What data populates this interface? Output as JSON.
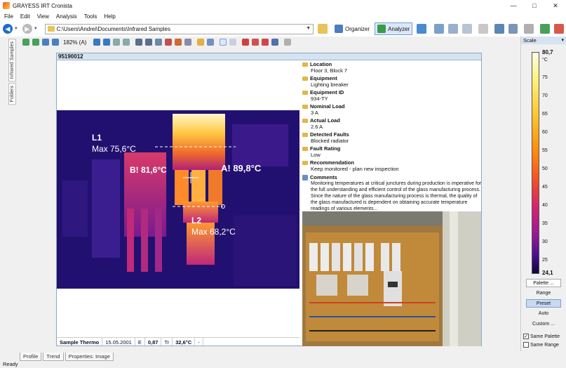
{
  "window": {
    "title": "GRAYESS IRT Cronista"
  },
  "menu": [
    "File",
    "Edit",
    "View",
    "Analysis",
    "Tools",
    "Help"
  ],
  "toolbar": {
    "path": "C:\\Users\\Andrei\\Documents\\Infrared Samples",
    "organizer_label": "Organizer",
    "analyzer_label": "Analyzer"
  },
  "image_toolbar": {
    "zoom": "182% (A)"
  },
  "left_tabs": [
    "Infrared Samples",
    "Folders"
  ],
  "image_panel": {
    "id": "95190012"
  },
  "thermal": {
    "labels": {
      "l1_name": "L1",
      "l1_max": "Max 75,6°C",
      "b_point": "B! 81,6°C",
      "a_point": "A! 89,8°C",
      "l2_name": "L2",
      "l2_max": "Max 68,2°C"
    }
  },
  "properties": [
    {
      "label": "Location",
      "value": "Floor 3, Block 7"
    },
    {
      "label": "Equipment",
      "value": "Lighting breaker"
    },
    {
      "label": "Equipment ID",
      "value": "934-TY"
    },
    {
      "label": "Nominal Load",
      "value": "3 A"
    },
    {
      "label": "Actual Load",
      "value": "2.6 A"
    },
    {
      "label": "Detected Faults",
      "value": "Blocked radiator"
    },
    {
      "label": "Fault Rating",
      "value": "Low"
    },
    {
      "label": "Recommendation",
      "value": "Keep monitored - plan new inspection"
    }
  ],
  "comments": {
    "label": "Comments",
    "text": "Monitoring temperatures at critical junctures during production is imperative for the full understanding and efficient control of the glass manufacturing process. Since the nature of the glass manufacturing process is thermal, the quality of the glass manufactured is dependent on obtaining accurate temperature readings of various elements..."
  },
  "infobar": {
    "camera": "Sample Thermo",
    "date": "15.05.2001",
    "e_label": "E",
    "e_value": "0,87",
    "tr_label": "Tr",
    "tr_value": "32,6°C",
    "extra": "-"
  },
  "bottom_tabs": [
    "Profile",
    "Trend",
    "Properties: Image"
  ],
  "status": "Ready",
  "scale": {
    "title": "Scale",
    "max": "80,7",
    "unit": "°C",
    "ticks": [
      "75",
      "70",
      "65",
      "60",
      "55",
      "50",
      "45",
      "40",
      "35",
      "30",
      "25"
    ],
    "min": "24,1",
    "palette_btn": "Palette ...",
    "range": "Range",
    "preset": "Preset",
    "auto": "Auto",
    "custom": "Custom ...",
    "same_palette": "Same Palette",
    "same_range": "Same Range",
    "same_palette_checked": true,
    "same_range_checked": false
  },
  "colors": {
    "accent": "#1f6fc4",
    "panel_header": "#d6e3f1",
    "thermal_bg": "#1d0d6a"
  }
}
